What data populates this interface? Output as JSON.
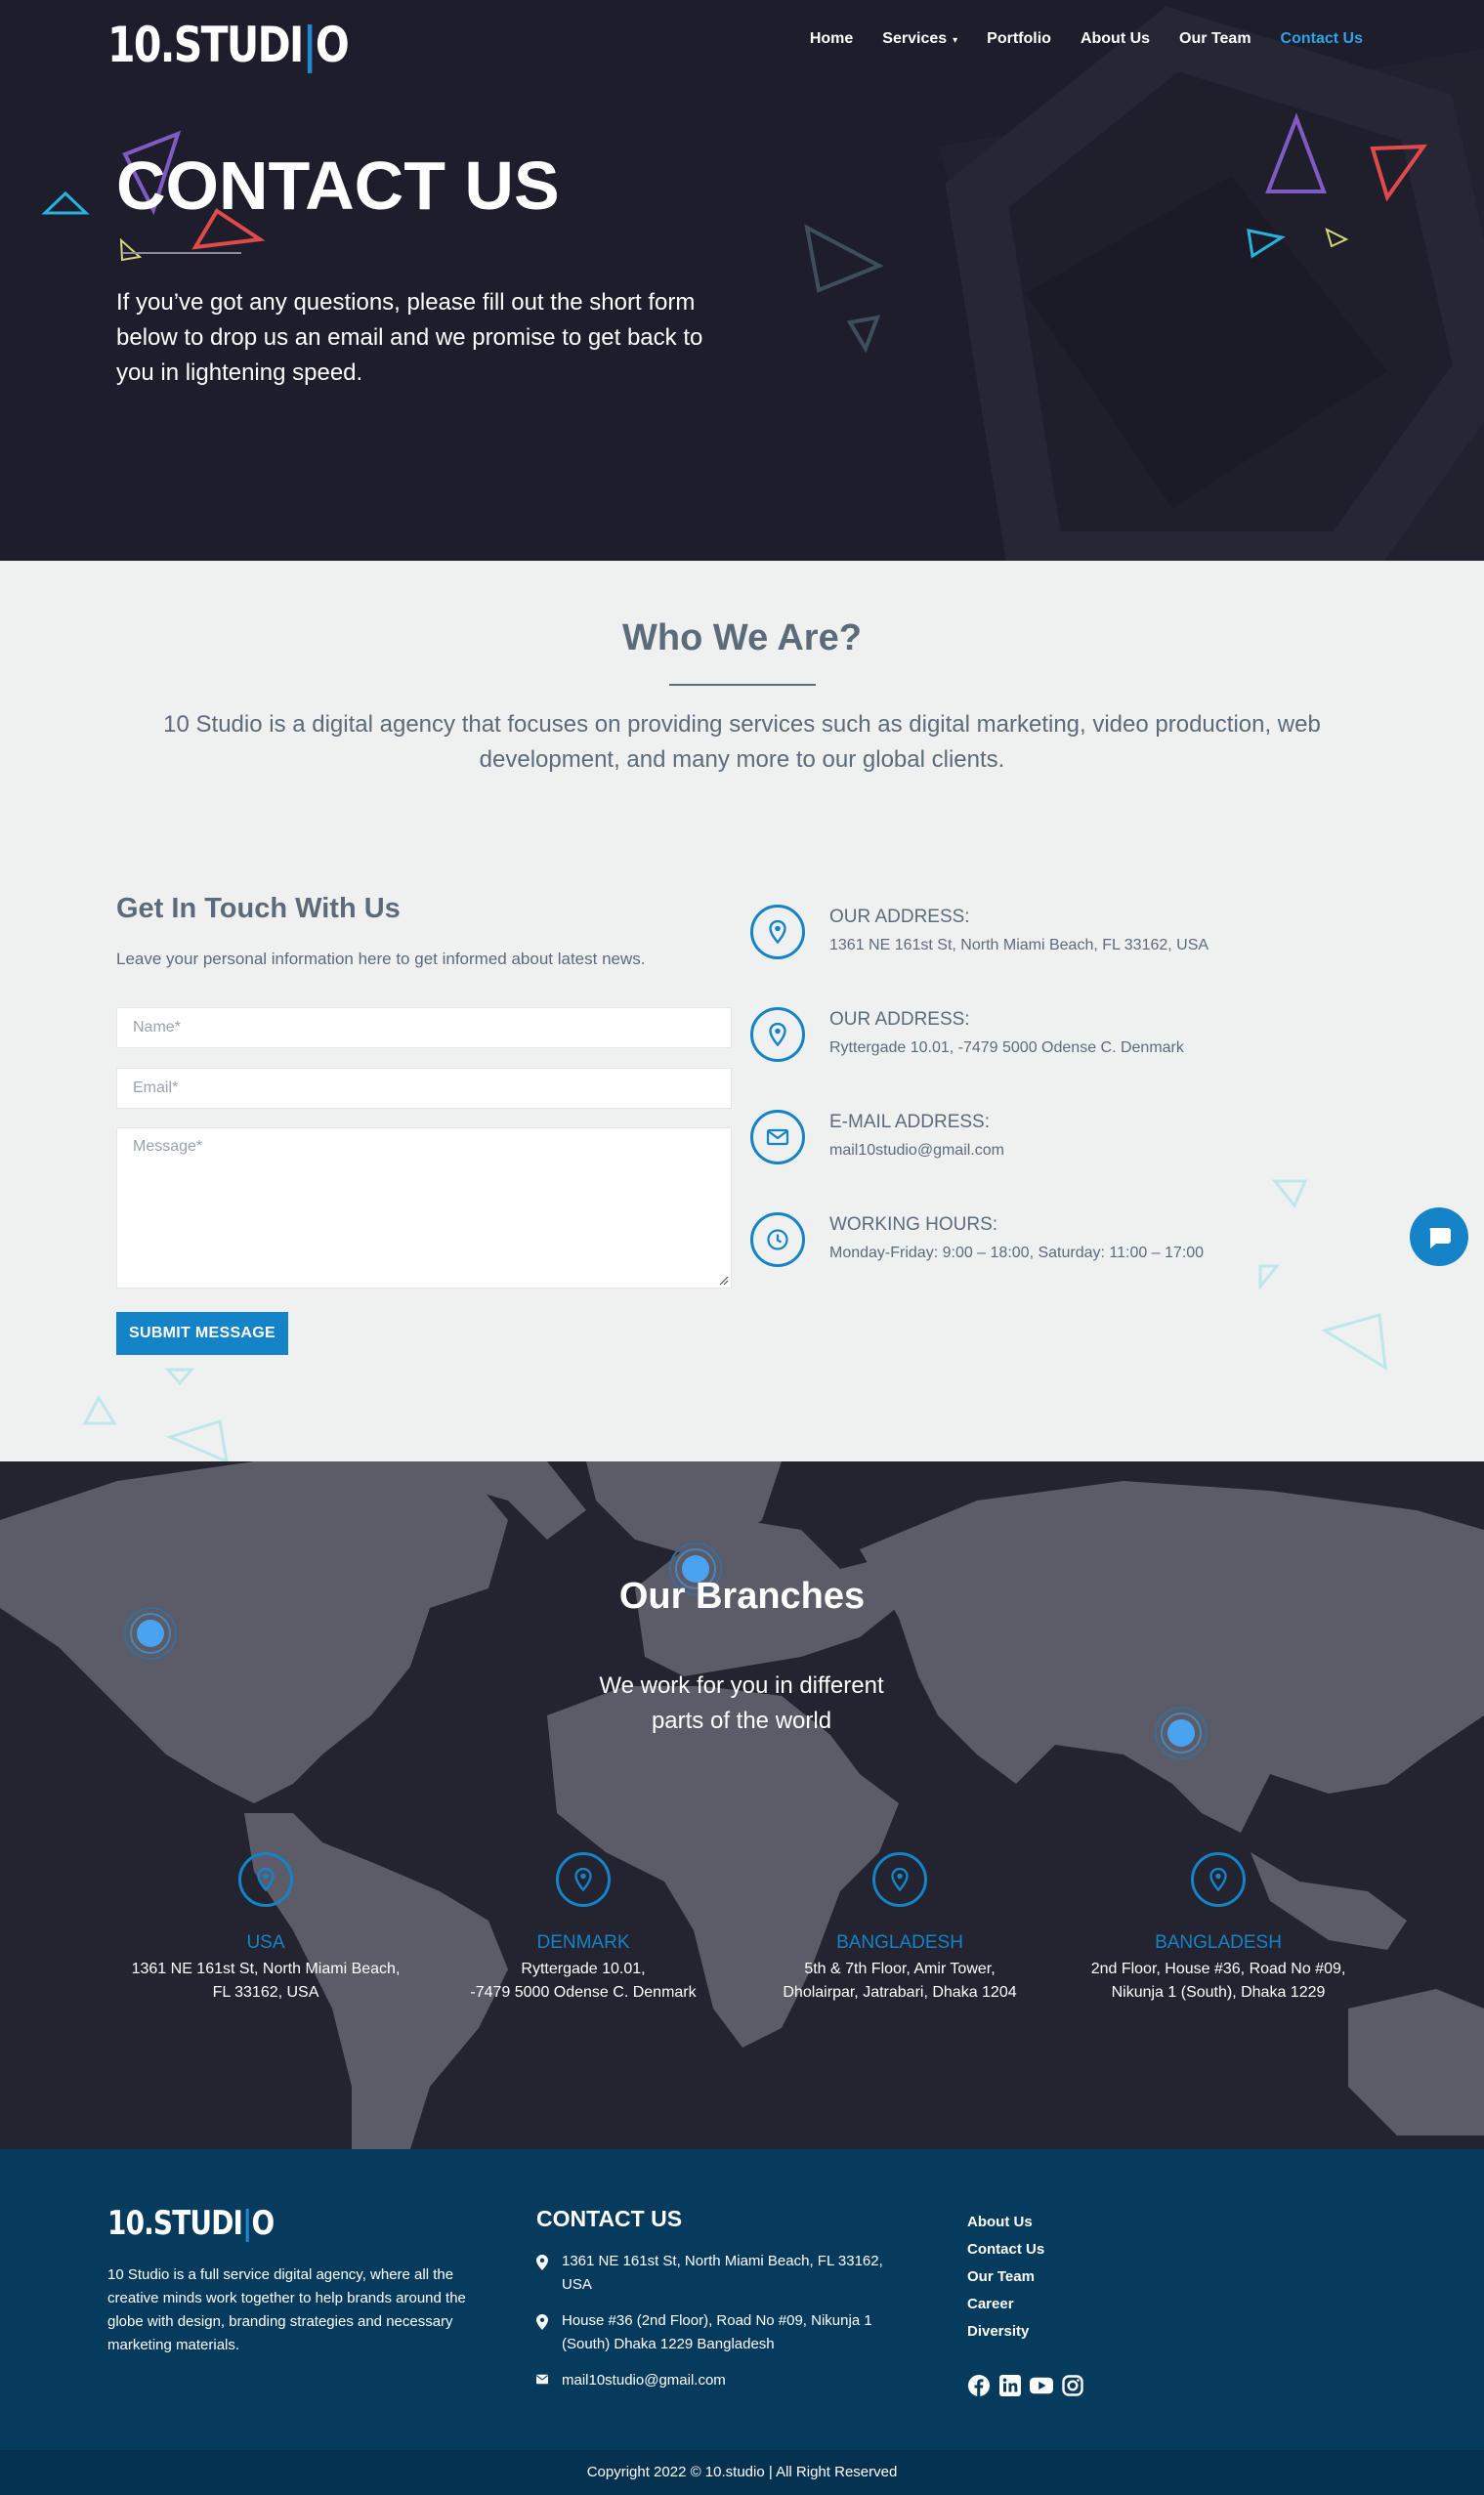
{
  "header": {
    "logo_text": "10.STUDI",
    "logo_bar": "|",
    "logo_end": "O",
    "nav": [
      "Home",
      "Services",
      "Portfolio",
      "About Us",
      "Our Team",
      "Contact Us"
    ],
    "services_caret": "▾"
  },
  "hero": {
    "title": "CONTACT US",
    "text": "If you’ve got any questions, please fill out the short form below to drop us an email and we promise to get back to you in lightening speed."
  },
  "who": {
    "title": "Who We Are?",
    "text": "10 Studio is a digital agency that focuses on providing services such as digital marketing, video production, web development, and many more to our global clients."
  },
  "contact_form": {
    "title": "Get In Touch With Us",
    "subtitle": "Leave your personal information here to get informed about latest news.",
    "name_placeholder": "Name*",
    "email_placeholder": "Email*",
    "message_placeholder": "Message*",
    "submit_label": "SUBMIT MESSAGE"
  },
  "info": [
    {
      "label": "OUR ADDRESS:",
      "value": "1361 NE 161st St, North Miami Beach, FL 33162, USA",
      "icon": "map-pin-icon"
    },
    {
      "label": "OUR ADDRESS:",
      "value": "Ryttergade 10.01, -7479 5000 Odense C. Denmark",
      "icon": "map-pin-icon"
    },
    {
      "label": "E-MAIL ADDRESS:",
      "value": "mail10studio@gmail.com",
      "icon": "envelope-icon"
    },
    {
      "label": "WORKING HOURS:",
      "value": "Monday-Friday: 9:00 – 18:00, Saturday: 11:00 – 17:00",
      "icon": "clock-icon"
    }
  ],
  "branches": {
    "title": "Our Branches",
    "text": "We work for you in different parts of the world",
    "items": [
      {
        "name": "USA",
        "line1": "1361 NE 161st St, North Miami Beach,",
        "line2": "FL 33162, USA"
      },
      {
        "name": "DENMARK",
        "line1": "Ryttergade 10.01,",
        "line2": "-7479 5000 Odense C. Denmark"
      },
      {
        "name": "BANGLADESH",
        "line1": "5th & 7th Floor, Amir Tower,",
        "line2": "Dholairpar, Jatrabari, Dhaka 1204"
      },
      {
        "name": "BANGLADESH",
        "line1": "2nd Floor, House #36, Road No #09,",
        "line2": "Nikunja 1 (South), Dhaka 1229"
      }
    ]
  },
  "footer": {
    "logo_text": "10.STUDI",
    "logo_bar": "|",
    "logo_end": "O",
    "about": "10 Studio is a full service digital agency, where all the creative minds work together to help brands around the globe with design, branding strategies and necessary marketing materials.",
    "contact_title": "CONTACT US",
    "address1": "1361 NE 161st St, North Miami Beach, FL 33162, USA",
    "address2": "House #36 (2nd Floor), Road No #09, Nikunja 1 (South) Dhaka 1229 Bangladesh",
    "email": "mail10studio@gmail.com",
    "links": [
      "About Us",
      "Contact Us",
      "Our Team",
      "Career",
      "Diversity"
    ],
    "socials": [
      "facebook-icon",
      "linkedin-icon",
      "youtube-icon",
      "instagram-icon"
    ],
    "copyright": "Copyright 2022 © 10.studio | All Right Reserved"
  },
  "colors": {
    "hero_bg": "#1d1d2b",
    "accent": "#1583c7",
    "nav_active": "#2ea3e6",
    "footer_bg": "#073b5e",
    "map_bg": "#252633"
  }
}
